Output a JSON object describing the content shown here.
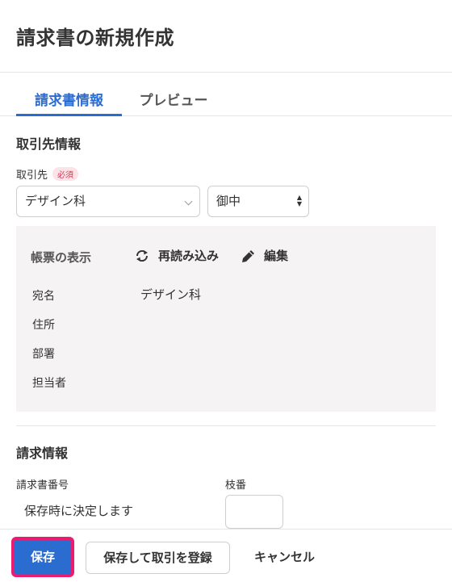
{
  "page": {
    "title": "請求書の新規作成"
  },
  "tabs": [
    {
      "label": "請求書情報",
      "active": true
    },
    {
      "label": "プレビュー",
      "active": false
    }
  ],
  "partner_section": {
    "title": "取引先情報",
    "field_label": "取引先",
    "required_badge": "必須",
    "partner_value": "デザイン科",
    "honorific_value": "御中"
  },
  "display_panel": {
    "heading": "帳票の表示",
    "reload_label": "再読み込み",
    "edit_label": "編集",
    "rows": [
      {
        "label": "宛名",
        "value": "デザイン科"
      },
      {
        "label": "住所",
        "value": ""
      },
      {
        "label": "部署",
        "value": ""
      },
      {
        "label": "担当者",
        "value": ""
      }
    ]
  },
  "invoice_section": {
    "title": "請求情報",
    "number_label": "請求書番号",
    "number_value": "保存時に決定します",
    "branch_label": "枝番",
    "branch_value": ""
  },
  "footer": {
    "save_label": "保存",
    "save_register_label": "保存して取引を登録",
    "cancel_label": "キャンセル"
  },
  "colors": {
    "accent": "#2b6cd0",
    "highlight_border": "#ec1b72",
    "required": "#d23a5a",
    "panel_bg": "#f5f3f3"
  },
  "icons": {
    "reload": "refresh-icon",
    "edit": "pencil-icon",
    "dropdown": "chevron-down-icon",
    "select_arrows": "updown-arrows-icon"
  }
}
